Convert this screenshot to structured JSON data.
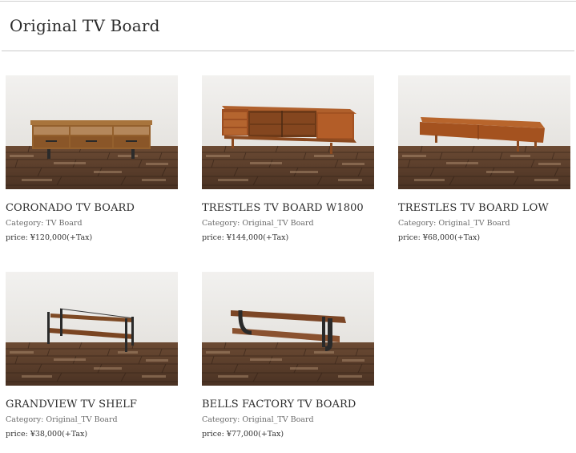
{
  "page": {
    "title": "Original TV Board"
  },
  "labels": {
    "category": "Category:",
    "price": "price:"
  },
  "products": [
    {
      "name": "CORONADO TV BOARD",
      "category": "TV Board",
      "price": "¥120,000(+Tax)",
      "image": "coronado-tv-board-photo"
    },
    {
      "name": "TRESTLES TV BOARD W1800",
      "category": "Original_TV Board",
      "price": "¥144,000(+Tax)",
      "image": "trestles-tv-board-w1800-photo"
    },
    {
      "name": "TRESTLES TV BOARD LOW",
      "category": "Original_TV Board",
      "price": "¥68,000(+Tax)",
      "image": "trestles-tv-board-low-photo"
    },
    {
      "name": "GRANDVIEW TV SHELF",
      "category": "Original_TV Board",
      "price": "¥38,000(+Tax)",
      "image": "grandview-tv-shelf-photo"
    },
    {
      "name": "BELLS FACTORY TV BOARD",
      "category": "Original_TV Board",
      "price": "¥77,000(+Tax)",
      "image": "bells-factory-tv-board-photo"
    }
  ]
}
